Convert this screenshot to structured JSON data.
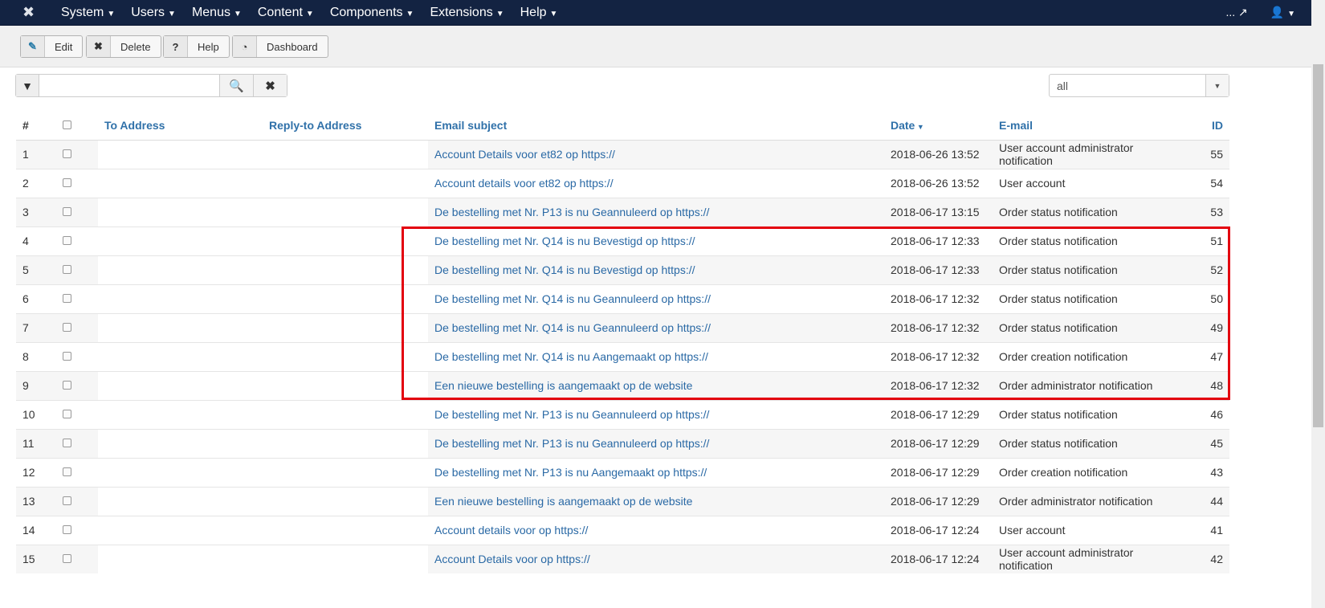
{
  "nav": {
    "menus": [
      "System",
      "Users",
      "Menus",
      "Content",
      "Components",
      "Extensions",
      "Help"
    ],
    "right_text": "..."
  },
  "toolbar": {
    "edit": "Edit",
    "delete": "Delete",
    "help": "Help",
    "dashboard": "Dashboard"
  },
  "filter": {
    "search_value": "",
    "select_value": "all"
  },
  "table": {
    "headers": {
      "num": "#",
      "to": "To Address",
      "reply": "Reply-to Address",
      "subject": "Email subject",
      "date": "Date",
      "email": "E-mail",
      "id": "ID"
    },
    "rows": [
      {
        "n": "1",
        "subject": "Account Details voor et82 op https://",
        "date": "2018-06-26 13:52",
        "email": "User account administrator notification",
        "id": "55"
      },
      {
        "n": "2",
        "subject": "Account details voor et82 op https://",
        "date": "2018-06-26 13:52",
        "email": "User account",
        "id": "54"
      },
      {
        "n": "3",
        "subject": "De bestelling met Nr. P13 is nu Geannuleerd op https://",
        "date": "2018-06-17 13:15",
        "email": "Order status notification",
        "id": "53"
      },
      {
        "n": "4",
        "subject": "De bestelling met Nr. Q14 is nu Bevestigd op https://",
        "date": "2018-06-17 12:33",
        "email": "Order status notification",
        "id": "51"
      },
      {
        "n": "5",
        "subject": "De bestelling met Nr. Q14 is nu Bevestigd op https://",
        "date": "2018-06-17 12:33",
        "email": "Order status notification",
        "id": "52"
      },
      {
        "n": "6",
        "subject": "De bestelling met Nr. Q14 is nu Geannuleerd op https://",
        "date": "2018-06-17 12:32",
        "email": "Order status notification",
        "id": "50"
      },
      {
        "n": "7",
        "subject": "De bestelling met Nr. Q14 is nu Geannuleerd op https://",
        "date": "2018-06-17 12:32",
        "email": "Order status notification",
        "id": "49"
      },
      {
        "n": "8",
        "subject": "De bestelling met Nr. Q14 is nu Aangemaakt op https://",
        "date": "2018-06-17 12:32",
        "email": "Order creation notification",
        "id": "47"
      },
      {
        "n": "9",
        "subject": "Een nieuwe bestelling is aangemaakt op de website",
        "date": "2018-06-17 12:32",
        "email": "Order administrator notification",
        "id": "48"
      },
      {
        "n": "10",
        "subject": "De bestelling met Nr. P13 is nu Geannuleerd op https://",
        "date": "2018-06-17 12:29",
        "email": "Order status notification",
        "id": "46"
      },
      {
        "n": "11",
        "subject": "De bestelling met Nr. P13 is nu Geannuleerd op https://",
        "date": "2018-06-17 12:29",
        "email": "Order status notification",
        "id": "45"
      },
      {
        "n": "12",
        "subject": "De bestelling met Nr. P13 is nu Aangemaakt op https://",
        "date": "2018-06-17 12:29",
        "email": "Order creation notification",
        "id": "43"
      },
      {
        "n": "13",
        "subject": "Een nieuwe bestelling is aangemaakt op de website",
        "date": "2018-06-17 12:29",
        "email": "Order administrator notification",
        "id": "44"
      },
      {
        "n": "14",
        "subject": "Account details voor          op https://",
        "date": "2018-06-17 12:24",
        "email": "User account",
        "id": "41"
      },
      {
        "n": "15",
        "subject": "Account Details voor          op https://",
        "date": "2018-06-17 12:24",
        "email": "User account administrator notification",
        "id": "42"
      }
    ]
  },
  "colors": {
    "navbar": "#132342",
    "link": "#2a69a5",
    "highlight": "#e3000f"
  }
}
